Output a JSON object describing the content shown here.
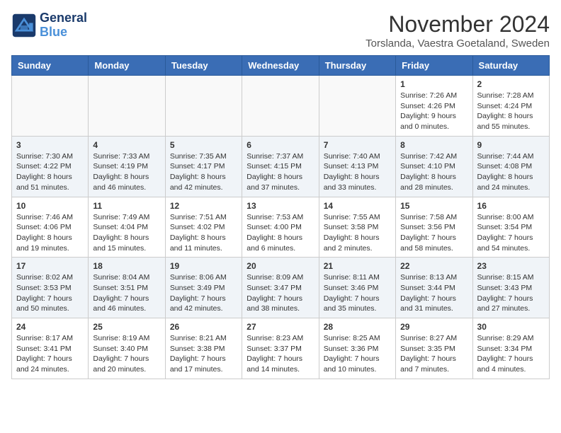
{
  "logo": {
    "line1": "General",
    "line2": "Blue"
  },
  "title": "November 2024",
  "subtitle": "Torslanda, Vaestra Goetaland, Sweden",
  "weekdays": [
    "Sunday",
    "Monday",
    "Tuesday",
    "Wednesday",
    "Thursday",
    "Friday",
    "Saturday"
  ],
  "weeks": [
    [
      {
        "day": "",
        "info": ""
      },
      {
        "day": "",
        "info": ""
      },
      {
        "day": "",
        "info": ""
      },
      {
        "day": "",
        "info": ""
      },
      {
        "day": "",
        "info": ""
      },
      {
        "day": "1",
        "info": "Sunrise: 7:26 AM\nSunset: 4:26 PM\nDaylight: 9 hours\nand 0 minutes."
      },
      {
        "day": "2",
        "info": "Sunrise: 7:28 AM\nSunset: 4:24 PM\nDaylight: 8 hours\nand 55 minutes."
      }
    ],
    [
      {
        "day": "3",
        "info": "Sunrise: 7:30 AM\nSunset: 4:22 PM\nDaylight: 8 hours\nand 51 minutes."
      },
      {
        "day": "4",
        "info": "Sunrise: 7:33 AM\nSunset: 4:19 PM\nDaylight: 8 hours\nand 46 minutes."
      },
      {
        "day": "5",
        "info": "Sunrise: 7:35 AM\nSunset: 4:17 PM\nDaylight: 8 hours\nand 42 minutes."
      },
      {
        "day": "6",
        "info": "Sunrise: 7:37 AM\nSunset: 4:15 PM\nDaylight: 8 hours\nand 37 minutes."
      },
      {
        "day": "7",
        "info": "Sunrise: 7:40 AM\nSunset: 4:13 PM\nDaylight: 8 hours\nand 33 minutes."
      },
      {
        "day": "8",
        "info": "Sunrise: 7:42 AM\nSunset: 4:10 PM\nDaylight: 8 hours\nand 28 minutes."
      },
      {
        "day": "9",
        "info": "Sunrise: 7:44 AM\nSunset: 4:08 PM\nDaylight: 8 hours\nand 24 minutes."
      }
    ],
    [
      {
        "day": "10",
        "info": "Sunrise: 7:46 AM\nSunset: 4:06 PM\nDaylight: 8 hours\nand 19 minutes."
      },
      {
        "day": "11",
        "info": "Sunrise: 7:49 AM\nSunset: 4:04 PM\nDaylight: 8 hours\nand 15 minutes."
      },
      {
        "day": "12",
        "info": "Sunrise: 7:51 AM\nSunset: 4:02 PM\nDaylight: 8 hours\nand 11 minutes."
      },
      {
        "day": "13",
        "info": "Sunrise: 7:53 AM\nSunset: 4:00 PM\nDaylight: 8 hours\nand 6 minutes."
      },
      {
        "day": "14",
        "info": "Sunrise: 7:55 AM\nSunset: 3:58 PM\nDaylight: 8 hours\nand 2 minutes."
      },
      {
        "day": "15",
        "info": "Sunrise: 7:58 AM\nSunset: 3:56 PM\nDaylight: 7 hours\nand 58 minutes."
      },
      {
        "day": "16",
        "info": "Sunrise: 8:00 AM\nSunset: 3:54 PM\nDaylight: 7 hours\nand 54 minutes."
      }
    ],
    [
      {
        "day": "17",
        "info": "Sunrise: 8:02 AM\nSunset: 3:53 PM\nDaylight: 7 hours\nand 50 minutes."
      },
      {
        "day": "18",
        "info": "Sunrise: 8:04 AM\nSunset: 3:51 PM\nDaylight: 7 hours\nand 46 minutes."
      },
      {
        "day": "19",
        "info": "Sunrise: 8:06 AM\nSunset: 3:49 PM\nDaylight: 7 hours\nand 42 minutes."
      },
      {
        "day": "20",
        "info": "Sunrise: 8:09 AM\nSunset: 3:47 PM\nDaylight: 7 hours\nand 38 minutes."
      },
      {
        "day": "21",
        "info": "Sunrise: 8:11 AM\nSunset: 3:46 PM\nDaylight: 7 hours\nand 35 minutes."
      },
      {
        "day": "22",
        "info": "Sunrise: 8:13 AM\nSunset: 3:44 PM\nDaylight: 7 hours\nand 31 minutes."
      },
      {
        "day": "23",
        "info": "Sunrise: 8:15 AM\nSunset: 3:43 PM\nDaylight: 7 hours\nand 27 minutes."
      }
    ],
    [
      {
        "day": "24",
        "info": "Sunrise: 8:17 AM\nSunset: 3:41 PM\nDaylight: 7 hours\nand 24 minutes."
      },
      {
        "day": "25",
        "info": "Sunrise: 8:19 AM\nSunset: 3:40 PM\nDaylight: 7 hours\nand 20 minutes."
      },
      {
        "day": "26",
        "info": "Sunrise: 8:21 AM\nSunset: 3:38 PM\nDaylight: 7 hours\nand 17 minutes."
      },
      {
        "day": "27",
        "info": "Sunrise: 8:23 AM\nSunset: 3:37 PM\nDaylight: 7 hours\nand 14 minutes."
      },
      {
        "day": "28",
        "info": "Sunrise: 8:25 AM\nSunset: 3:36 PM\nDaylight: 7 hours\nand 10 minutes."
      },
      {
        "day": "29",
        "info": "Sunrise: 8:27 AM\nSunset: 3:35 PM\nDaylight: 7 hours\nand 7 minutes."
      },
      {
        "day": "30",
        "info": "Sunrise: 8:29 AM\nSunset: 3:34 PM\nDaylight: 7 hours\nand 4 minutes."
      }
    ]
  ]
}
